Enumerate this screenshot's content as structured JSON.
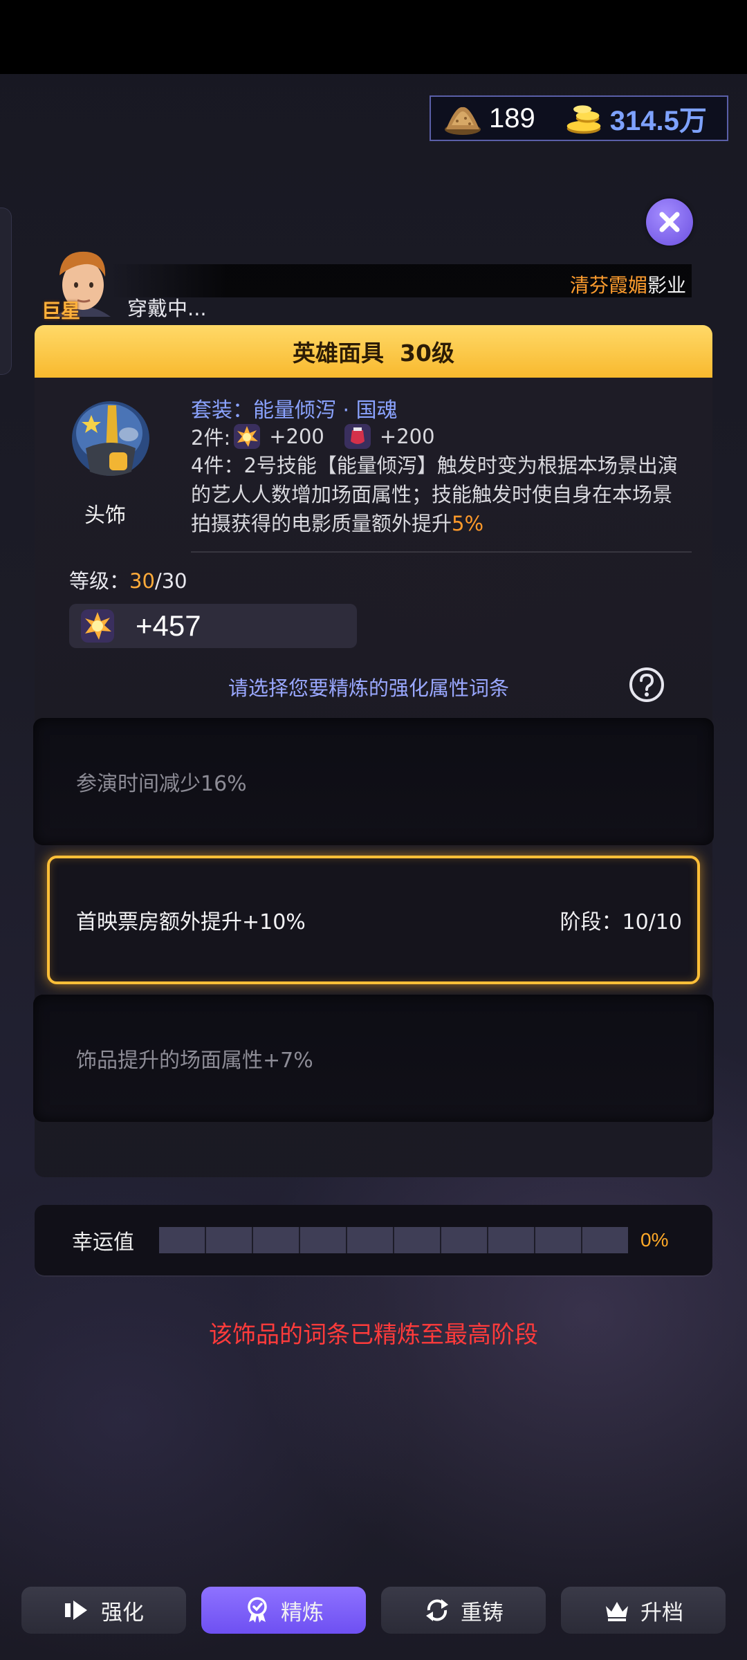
{
  "currency": {
    "material": "189",
    "gold": "314.5万"
  },
  "profile": {
    "status": "穿戴中...",
    "badge": "巨星",
    "studio_highlight": "清芬霞媚",
    "studio_suffix": "影业"
  },
  "item": {
    "title": "英雄面具  30级",
    "slot_label": "头饰",
    "set_name": "套装：能量倾泻 · 国魂",
    "set_2_label": "2件:",
    "set_2_bonus_a": "+200",
    "set_2_bonus_b": "+200",
    "set_4_text": "4件：2号技能【能量倾泻】触发时变为根据本场景出演的艺人人数增加场面属性；技能触发时使自身在本场景拍摄获得的电影质量额外提升",
    "set_4_highlight": "5%",
    "level_label": "等级：",
    "level_current": "30",
    "level_max": "/30",
    "stat_value": "+457"
  },
  "refine": {
    "prompt": "请选择您要精炼的强化属性词条",
    "options": [
      {
        "text": "参演时间减少16%",
        "selected": false
      },
      {
        "text": "首映票房额外提升+10%",
        "stage": "阶段：10/10",
        "selected": true
      },
      {
        "text": "饰品提升的场面属性+7%",
        "selected": false
      }
    ]
  },
  "luck": {
    "label": "幸运值",
    "percent": "0%",
    "progress": 0,
    "segments": 10
  },
  "message": "该饰品的词条已精炼至最高阶段",
  "tabs": [
    {
      "label": "强化",
      "icon": "arrow-right-icon",
      "active": false
    },
    {
      "label": "精炼",
      "icon": "medal-icon",
      "active": true
    },
    {
      "label": "重铸",
      "icon": "refresh-icon",
      "active": false
    },
    {
      "label": "升档",
      "icon": "crown-icon",
      "active": false
    }
  ],
  "colors": {
    "accent": "#7b5cf5",
    "gold_bar": "#f8b92e",
    "highlight": "#ff9a2a",
    "error": "#ff3b3b",
    "link": "#8ba3ff"
  }
}
